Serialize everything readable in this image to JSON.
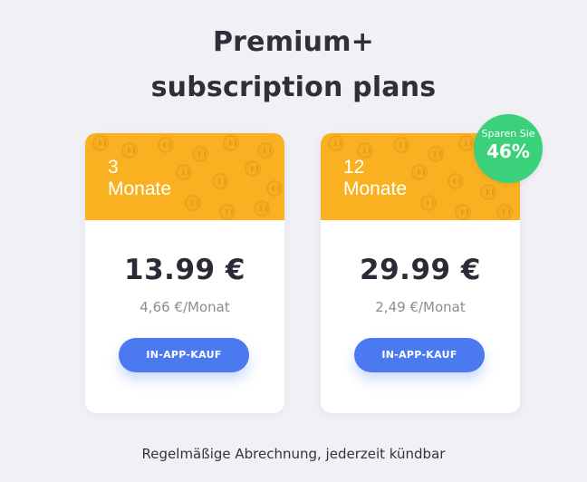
{
  "header": {
    "title_line1": "Premium+",
    "title_line2": "subscription plans"
  },
  "plans": [
    {
      "duration_number": "3",
      "duration_unit": "Monate",
      "price": "13.99 €",
      "per_month": "4,66 €/Monat",
      "button_label": "IN-APP-KAUF"
    },
    {
      "duration_number": "12",
      "duration_unit": "Monate",
      "price": "29.99 €",
      "per_month": "2,49 €/Monat",
      "button_label": "IN-APP-KAUF"
    }
  ],
  "badge": {
    "label": "Sparen Sie",
    "percent": "46%"
  },
  "footer": {
    "note": "Regelmäßige Abrechnung, jederzeit kündbar"
  },
  "colors": {
    "page_background": "#f0f0f5",
    "card_header": "#f9b122",
    "button": "#4a79f0",
    "badge": "#3bd07a"
  }
}
